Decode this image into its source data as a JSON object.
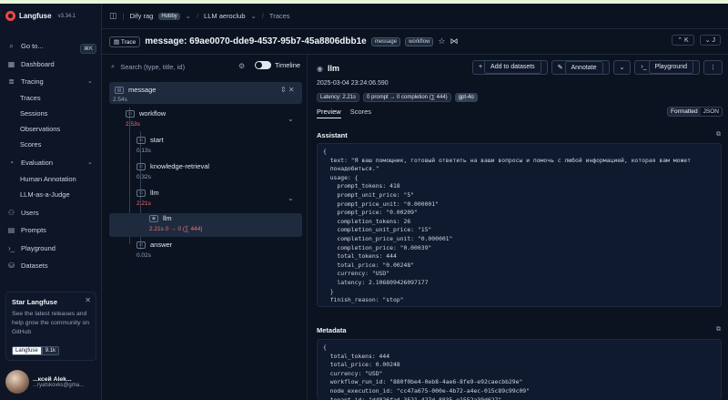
{
  "app": {
    "name": "Langfuse",
    "version": "v3.34.1"
  },
  "sidebar": {
    "goto": "Go to...",
    "goto_kbd": "⌘K",
    "items": [
      {
        "label": "Dashboard"
      },
      {
        "label": "Tracing"
      },
      {
        "label": "Evaluation"
      },
      {
        "label": "Users"
      },
      {
        "label": "Prompts"
      },
      {
        "label": "Playground"
      },
      {
        "label": "Datasets"
      }
    ],
    "tracing_sub": [
      "Traces",
      "Sessions",
      "Observations",
      "Scores"
    ],
    "evaluation_sub": [
      "Human Annotation",
      "LLM-as-a-Judge"
    ],
    "star": {
      "title": "Star Langfuse",
      "desc": "See the latest releases and help grow the community on GitHub",
      "gh_label": "Langfuse",
      "gh_count": "9.1k"
    },
    "user": {
      "name": "...ксей Alek...",
      "email": "...ryatskovks@gma..."
    }
  },
  "header": {
    "project": "Dify rag",
    "plan": "Hobby",
    "org": "LLM aeroclub",
    "section": "Traces"
  },
  "titlebar": {
    "badge": "Trace",
    "title": "message: 69ae0070-dde9-4537-95b7-45a8806dbb1e",
    "tags": [
      "message",
      "workflow"
    ]
  },
  "tree": {
    "search_placeholder": "Search (type, title, id)",
    "timeline": "Timeline",
    "nodes": [
      {
        "name": "message",
        "meta": "2.54s"
      },
      {
        "name": "workflow",
        "meta": "2.53s"
      },
      {
        "name": "start",
        "meta": "0.13s"
      },
      {
        "name": "knowledge-retrieval",
        "meta": "0.32s"
      },
      {
        "name": "llm",
        "meta": "2.21s"
      },
      {
        "name": "llm",
        "meta": "2.21s  0 → 0 (∑ 444)"
      },
      {
        "name": "answer",
        "meta": "0.02s"
      }
    ]
  },
  "detail": {
    "title": "llm",
    "timestamp": "2025-03-04 23:24:06.590",
    "buttons": [
      "Add to datasets",
      "Annotate",
      "Playground"
    ],
    "pills": [
      "Latency: 2.21s",
      "0 prompt → 0 completion (∑ 444)",
      "gpt-4o"
    ],
    "tabs": [
      "Preview",
      "Scores"
    ],
    "format": [
      "Formatted",
      "JSON"
    ],
    "assistant_label": "Assistant",
    "assistant_json": "{\n  text: \"Я ваш помощник, готовый ответить на ваши вопросы и помочь с любой информацией, которая вам может\n  понадобиться.\"\n  usage: {\n    prompt_tokens: 418\n    prompt_unit_price: \"5\"\n    prompt_price_unit: \"0.000001\"\n    prompt_price: \"0.00209\"\n    completion_tokens: 26\n    completion_unit_price: \"15\"\n    completion_price_unit: \"0.000001\"\n    completion_price: \"0.00039\"\n    total_tokens: 444\n    total_price: \"0.00248\"\n    currency: \"USD\"\n    latency: 2.106809426097177\n  }\n  finish_reason: \"stop\"\n}",
    "metadata_label": "Metadata",
    "metadata_json": "{\n  total_tokens: 444\n  total_price: 0.00248\n  currency: \"USD\"\n  workflow_run_id: \"880f0be4-0eb8-4ae6-8fe9-e92caecbb29e\"\n  node_execution_id: \"cc47a675-000e-4b72-a4ec-015c89c99c09\"\n  tenant_id: \"d4826fad-3521-427d-8835-e1552a39d627\""
  }
}
